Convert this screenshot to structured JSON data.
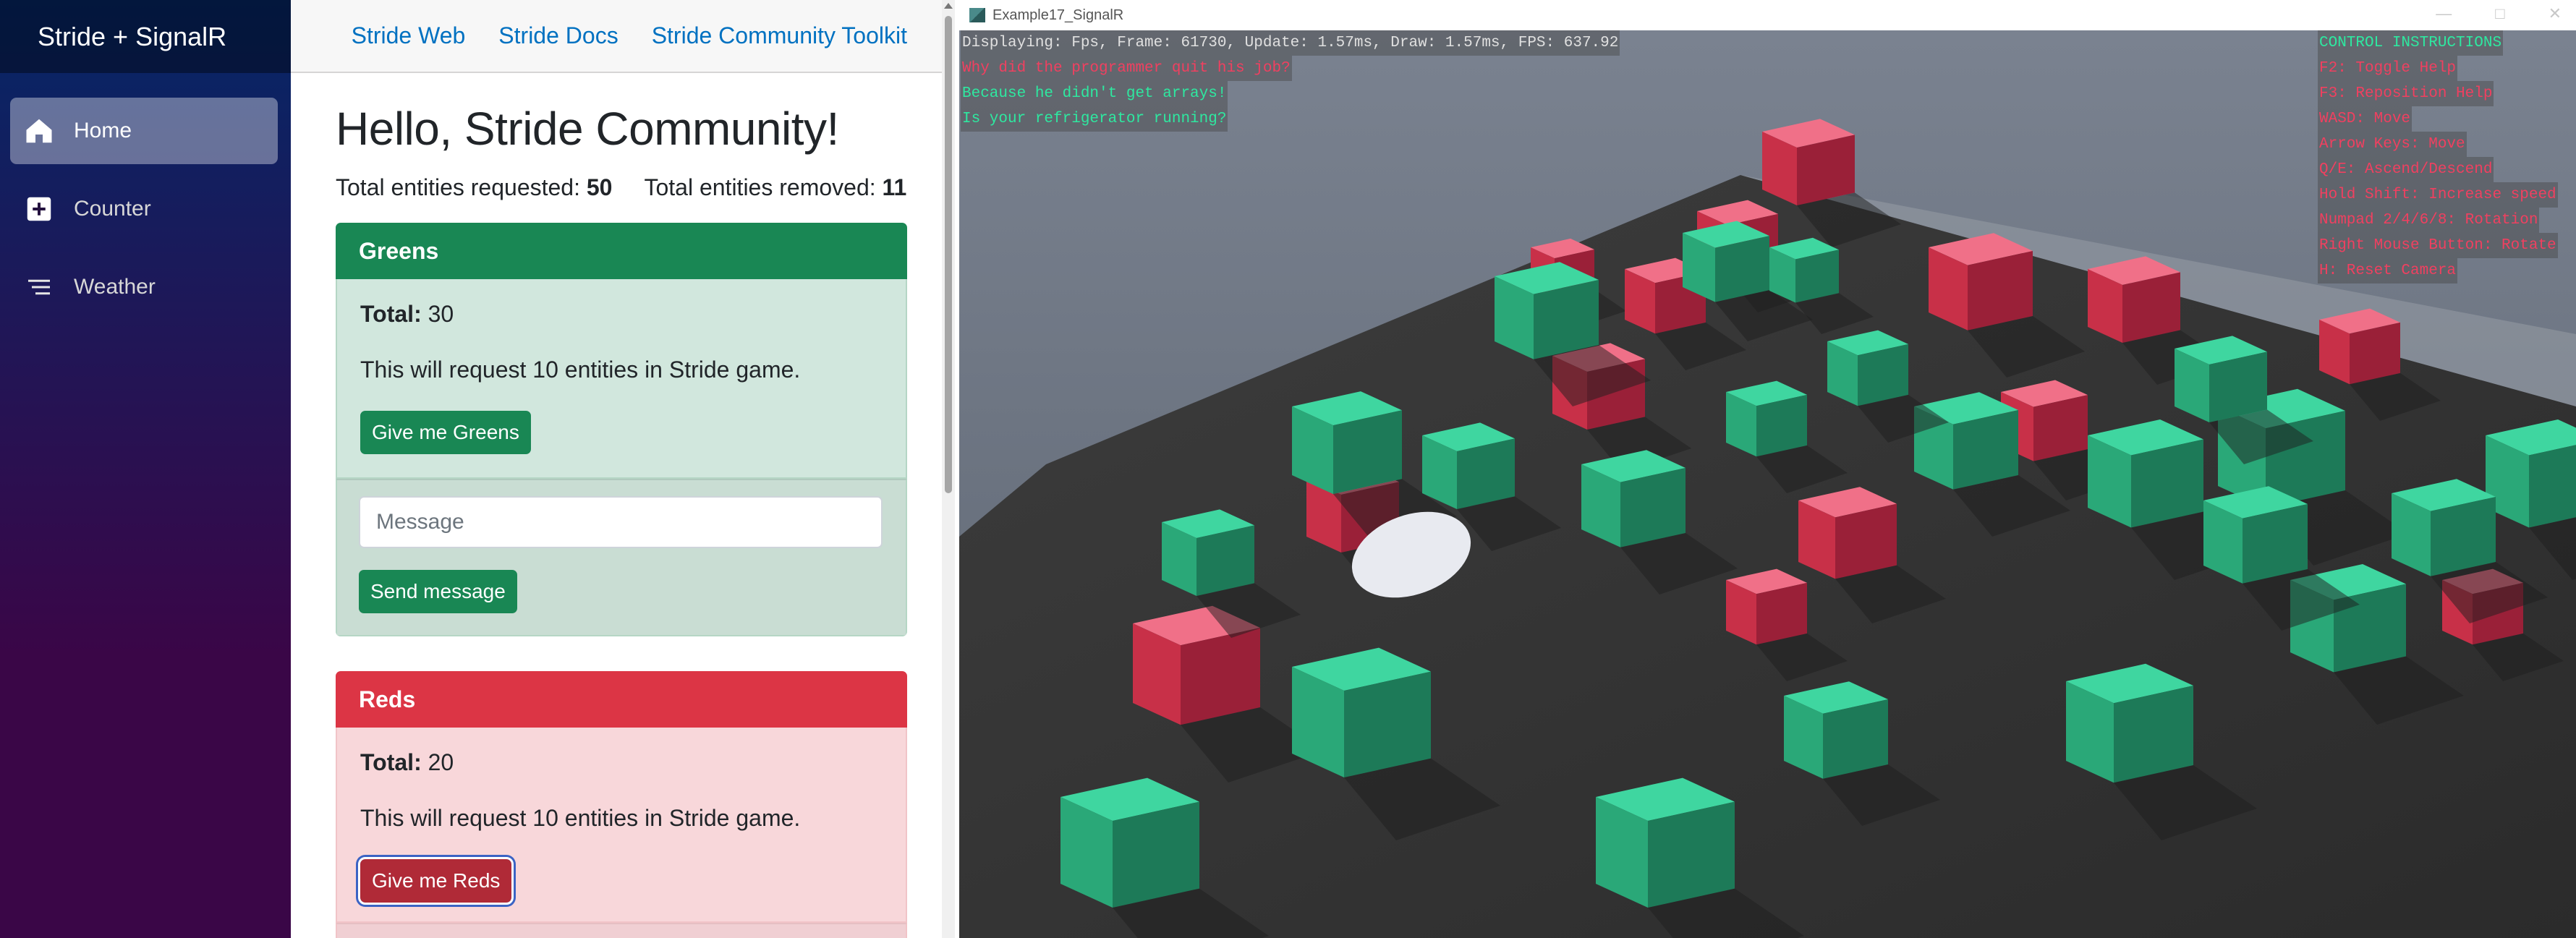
{
  "sidebar": {
    "brand": "Stride + SignalR",
    "items": [
      {
        "label": "Home",
        "icon": "home-icon",
        "active": true
      },
      {
        "label": "Counter",
        "icon": "plus-icon",
        "active": false
      },
      {
        "label": "Weather",
        "icon": "list-icon",
        "active": false
      }
    ]
  },
  "topbar": {
    "links": [
      "Stride Web",
      "Stride Docs",
      "Stride Community Toolkit"
    ]
  },
  "main": {
    "title": "Hello, Stride Community!",
    "requested_label": "Total entities requested:",
    "requested_value": "50",
    "removed_label": "Total entities removed:",
    "removed_value": "11"
  },
  "greens": {
    "header": "Greens",
    "total_label": "Total:",
    "total_value": "30",
    "description": "This will request 10 entities in Stride game.",
    "button": "Give me Greens",
    "message_placeholder": "Message",
    "send_button": "Send message",
    "color": "#198754"
  },
  "reds": {
    "header": "Reds",
    "total_label": "Total:",
    "total_value": "20",
    "description": "This will request 10 entities in Stride game.",
    "button": "Give me Reds",
    "color": "#dc3545"
  },
  "game_window": {
    "title": "Example17_SignalR",
    "debug_lines": [
      {
        "text": "Displaying: Fps, Frame: 61730, Update: 1.57ms, Draw: 1.57ms, FPS: 637.92",
        "color": "white"
      },
      {
        "text": "Why did the programmer quit his job?",
        "color": "red"
      },
      {
        "text": "Because he didn't get arrays!",
        "color": "green"
      },
      {
        "text": "Is your refrigerator running?",
        "color": "green"
      }
    ],
    "control_lines": [
      {
        "text": "CONTROL INSTRUCTIONS",
        "color": "green"
      },
      {
        "text": "F2: Toggle Help",
        "color": "red"
      },
      {
        "text": "F3: Reposition Help",
        "color": "red"
      },
      {
        "text": "WASD: Move",
        "color": "red"
      },
      {
        "text": "Arrow Keys: Move",
        "color": "red"
      },
      {
        "text": "Q/E: Ascend/Descend",
        "color": "red"
      },
      {
        "text": "Hold Shift: Increase speed",
        "color": "red"
      },
      {
        "text": "Numpad 2/4/6/8: Rotation",
        "color": "red"
      },
      {
        "text": "Right Mouse Button: Rotate",
        "color": "red"
      },
      {
        "text": "H: Reset Camera",
        "color": "red"
      }
    ]
  }
}
